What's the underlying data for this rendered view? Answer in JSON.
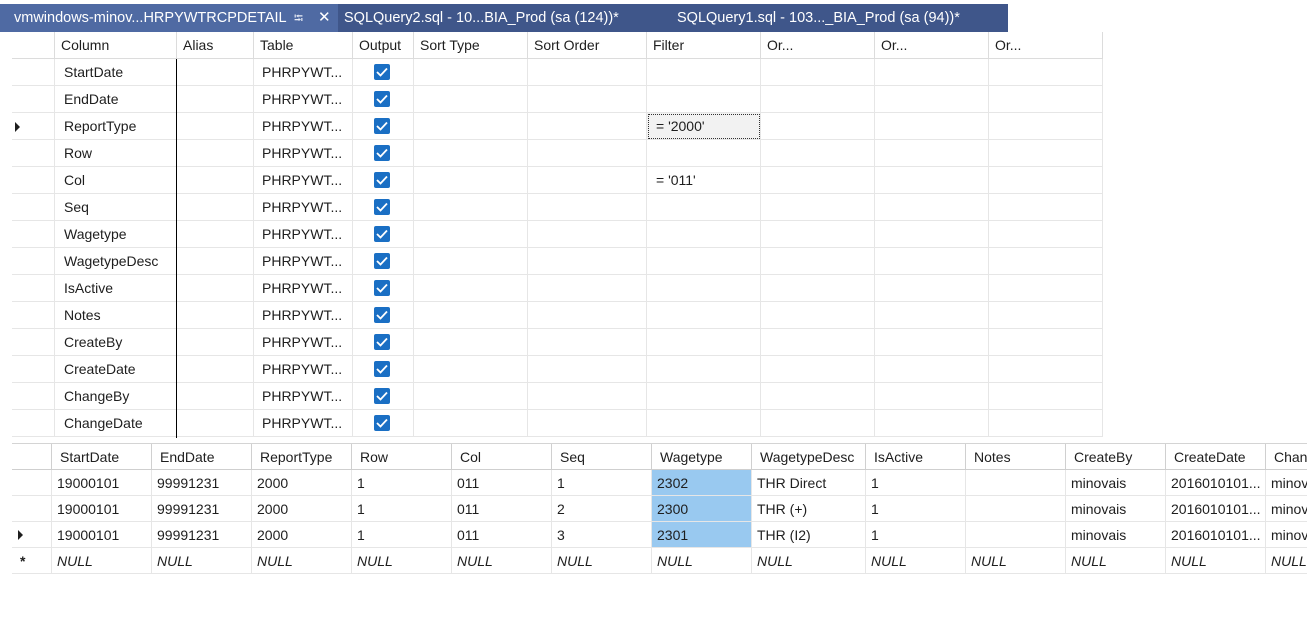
{
  "tabs": [
    {
      "label": "vmwindows-minov...HRPYWTRCPDETAIL",
      "active": true
    },
    {
      "label": "SQLQuery2.sql - 10...BIA_Prod (sa (124))*",
      "active": false
    },
    {
      "label": "SQLQuery1.sql - 103..._BIA_Prod (sa (94))*",
      "active": false
    }
  ],
  "criteria": {
    "headers": {
      "column": "Column",
      "alias": "Alias",
      "table": "Table",
      "output": "Output",
      "sort_type": "Sort Type",
      "sort_order": "Sort Order",
      "filter": "Filter",
      "or1": "Or...",
      "or2": "Or...",
      "or3": "Or..."
    },
    "rows": [
      {
        "column": "StartDate",
        "table": "PHRPYWT...",
        "filter": ""
      },
      {
        "column": "EndDate",
        "table": "PHRPYWT...",
        "filter": ""
      },
      {
        "column": "ReportType",
        "table": "PHRPYWT...",
        "filter": "= '2000'"
      },
      {
        "column": "Row",
        "table": "PHRPYWT...",
        "filter": ""
      },
      {
        "column": "Col",
        "table": "PHRPYWT...",
        "filter": "= '011'"
      },
      {
        "column": "Seq",
        "table": "PHRPYWT...",
        "filter": ""
      },
      {
        "column": "Wagetype",
        "table": "PHRPYWT...",
        "filter": ""
      },
      {
        "column": "WagetypeDesc",
        "table": "PHRPYWT...",
        "filter": ""
      },
      {
        "column": "IsActive",
        "table": "PHRPYWT...",
        "filter": ""
      },
      {
        "column": "Notes",
        "table": "PHRPYWT...",
        "filter": ""
      },
      {
        "column": "CreateBy",
        "table": "PHRPYWT...",
        "filter": ""
      },
      {
        "column": "CreateDate",
        "table": "PHRPYWT...",
        "filter": ""
      },
      {
        "column": "ChangeBy",
        "table": "PHRPYWT...",
        "filter": ""
      },
      {
        "column": "ChangeDate",
        "table": "PHRPYWT...",
        "filter": ""
      }
    ]
  },
  "results": {
    "headers": [
      "StartDate",
      "EndDate",
      "ReportType",
      "Row",
      "Col",
      "Seq",
      "Wagetype",
      "WagetypeDesc",
      "IsActive",
      "Notes",
      "CreateBy",
      "CreateDate",
      "Chan"
    ],
    "rows": [
      [
        "19000101",
        "99991231",
        "2000",
        "1",
        "011",
        "1",
        "2302",
        "THR Direct",
        "1",
        "",
        "minovais",
        "2016010101...",
        "minov"
      ],
      [
        "19000101",
        "99991231",
        "2000",
        "1",
        "011",
        "2",
        "2300",
        "THR (+)",
        "1",
        "",
        "minovais",
        "2016010101...",
        "minov"
      ],
      [
        "19000101",
        "99991231",
        "2000",
        "1",
        "011",
        "3",
        "2301",
        "THR (I2)",
        "1",
        "",
        "minovais",
        "2016010101...",
        "minov"
      ],
      [
        "NULL",
        "NULL",
        "NULL",
        "NULL",
        "NULL",
        "NULL",
        "NULL",
        "NULL",
        "NULL",
        "NULL",
        "NULL",
        "NULL",
        "NULL"
      ]
    ],
    "new_row_marker": "*"
  },
  "colors": {
    "tab_bg": "#3f568a",
    "tab_active": "#4f6aa3",
    "checkbox": "#1a6fc4",
    "selected_cell": "#99c9f0"
  }
}
